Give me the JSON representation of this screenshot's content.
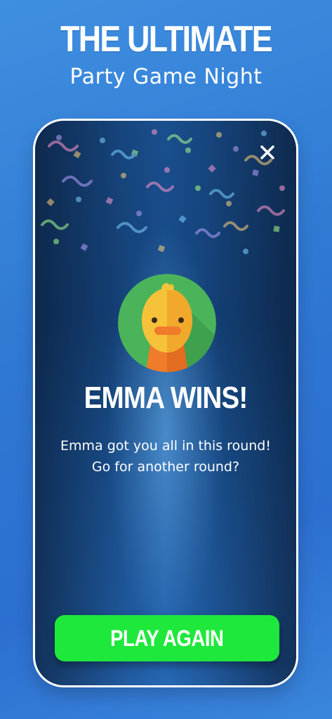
{
  "header": {
    "title": "THE ULTIMATE",
    "subtitle": "Party Game Night"
  },
  "modal": {
    "winner_title": "EMMA WINS!",
    "message_line1": "Emma got you all in this round!",
    "message_line2": "Go for another round?",
    "avatar_icon": "duck-avatar-icon",
    "close_icon": "close-icon",
    "play_again_label": "PLAY AGAIN"
  },
  "colors": {
    "background": "#2f78d3",
    "button": "#1fe83c",
    "avatar_circle": "#4bb45a",
    "duck_body": "#f6c23a",
    "duck_beak": "#f07b2b"
  }
}
